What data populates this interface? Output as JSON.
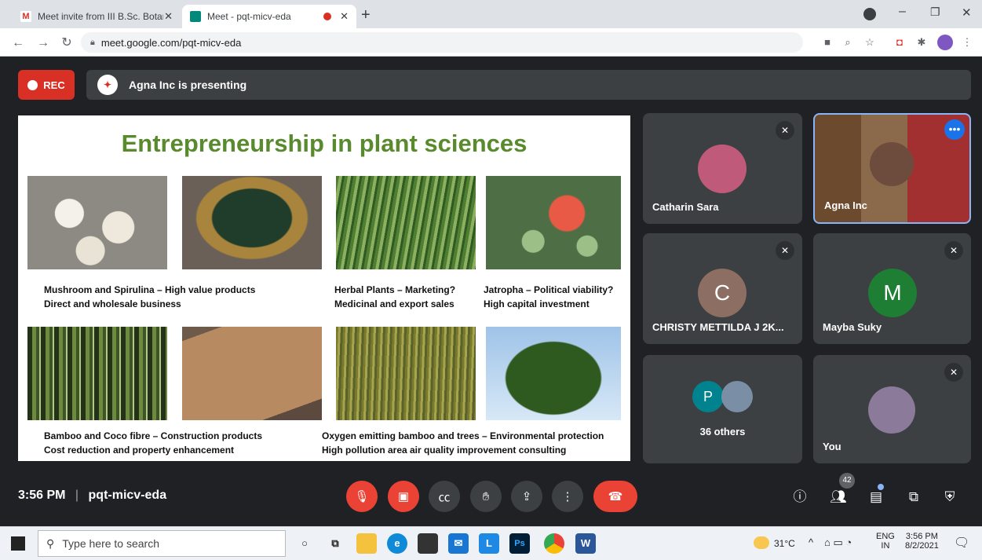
{
  "browser": {
    "tabs": [
      {
        "title": "Meet invite from III B.Sc. Botany |",
        "close": "✕"
      },
      {
        "title": "Meet - pqt-micv-eda",
        "close": "✕"
      }
    ],
    "new_tab": "+",
    "url": "meet.google.com/pqt-micv-eda"
  },
  "meet": {
    "rec_label": "REC",
    "presenting_text": "Agna Inc is presenting",
    "slide": {
      "title": "Entrepreneurship in plant sciences",
      "captions": [
        {
          "line1": "Mushroom and Spirulina – High value products",
          "line2": "Direct and wholesale business"
        },
        {
          "line1": "Herbal Plants – Marketing?",
          "line2": "Medicinal and export sales"
        },
        {
          "line1": "Jatropha – Political viability?",
          "line2": "High capital investment"
        },
        {
          "line1": "Bamboo and Coco fibre – Construction products",
          "line2": "Cost reduction and property enhancement"
        },
        {
          "line1": "Oxygen emitting bamboo and trees – Environmental protection",
          "line2": "High pollution area air quality improvement consulting"
        }
      ]
    },
    "participants": [
      {
        "name": "Catharin Sara"
      },
      {
        "name": "Agna Inc"
      },
      {
        "name": "CHRISTY METTILDA J 2K...",
        "initial": "C",
        "color": "#8d6e63"
      },
      {
        "name": "Mayba Suky",
        "initial": "M",
        "color": "#1e7e34"
      },
      {
        "name": "36 others",
        "initial": "P",
        "color": "#00838f"
      },
      {
        "name": "You"
      }
    ],
    "time": "3:56 PM",
    "meeting_code": "pqt-micv-eda",
    "people_count": "42"
  },
  "taskbar": {
    "search_placeholder": "Type here to search",
    "temperature": "31°C",
    "lang1": "ENG",
    "lang2": "IN",
    "time": "3:56 PM",
    "date": "8/2/2021"
  }
}
